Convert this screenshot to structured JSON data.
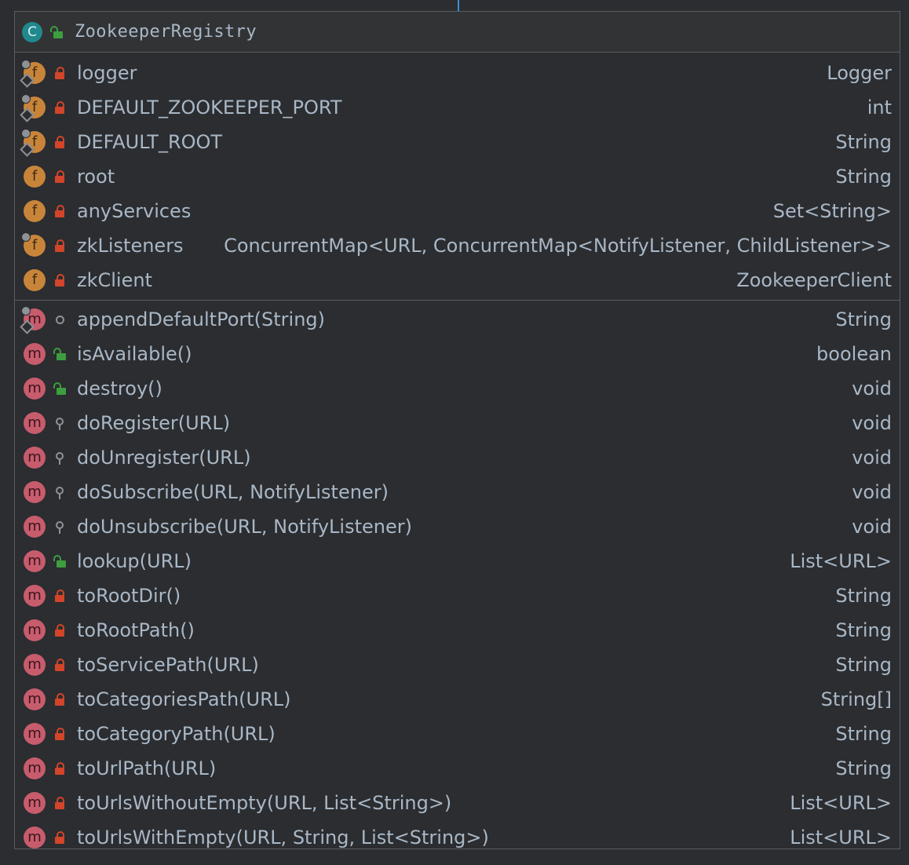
{
  "class": {
    "icon_letter": "C",
    "name": "ZookeeperRegistry",
    "visibility": "public"
  },
  "fields": [
    {
      "icon": "field-icon",
      "letter": "f",
      "static": true,
      "final": true,
      "visibility": "private",
      "name": "logger",
      "type": "Logger"
    },
    {
      "icon": "field-icon",
      "letter": "f",
      "static": true,
      "final": true,
      "visibility": "private",
      "name": "DEFAULT_ZOOKEEPER_PORT",
      "type": "int"
    },
    {
      "icon": "field-icon",
      "letter": "f",
      "static": true,
      "final": true,
      "visibility": "private",
      "name": "DEFAULT_ROOT",
      "type": "String"
    },
    {
      "icon": "field-icon",
      "letter": "f",
      "static": false,
      "final": false,
      "visibility": "private",
      "name": "root",
      "type": "String"
    },
    {
      "icon": "field-icon",
      "letter": "f",
      "static": false,
      "final": false,
      "visibility": "private",
      "name": "anyServices",
      "type": "Set<String>"
    },
    {
      "icon": "field-icon",
      "letter": "f",
      "static": true,
      "final": false,
      "visibility": "private",
      "name": "zkListeners",
      "type": "ConcurrentMap<URL, ConcurrentMap<NotifyListener, ChildListener>>"
    },
    {
      "icon": "field-icon",
      "letter": "f",
      "static": false,
      "final": false,
      "visibility": "private",
      "name": "zkClient",
      "type": "ZookeeperClient"
    }
  ],
  "methods": [
    {
      "icon": "method-icon",
      "letter": "m",
      "static": true,
      "final": true,
      "visibility": "package",
      "name": "appendDefaultPort(String)",
      "type": "String"
    },
    {
      "icon": "method-icon",
      "letter": "m",
      "static": false,
      "final": false,
      "visibility": "public",
      "name": "isAvailable()",
      "type": "boolean"
    },
    {
      "icon": "method-icon",
      "letter": "m",
      "static": false,
      "final": false,
      "visibility": "public",
      "name": "destroy()",
      "type": "void"
    },
    {
      "icon": "method-icon",
      "letter": "m",
      "static": false,
      "final": false,
      "visibility": "protected",
      "name": "doRegister(URL)",
      "type": "void"
    },
    {
      "icon": "method-icon",
      "letter": "m",
      "static": false,
      "final": false,
      "visibility": "protected",
      "name": "doUnregister(URL)",
      "type": "void"
    },
    {
      "icon": "method-icon",
      "letter": "m",
      "static": false,
      "final": false,
      "visibility": "protected",
      "name": "doSubscribe(URL, NotifyListener)",
      "type": "void"
    },
    {
      "icon": "method-icon",
      "letter": "m",
      "static": false,
      "final": false,
      "visibility": "protected",
      "name": "doUnsubscribe(URL, NotifyListener)",
      "type": "void"
    },
    {
      "icon": "method-icon",
      "letter": "m",
      "static": false,
      "final": false,
      "visibility": "public",
      "name": "lookup(URL)",
      "type": "List<URL>"
    },
    {
      "icon": "method-icon",
      "letter": "m",
      "static": false,
      "final": false,
      "visibility": "private",
      "name": "toRootDir()",
      "type": "String"
    },
    {
      "icon": "method-icon",
      "letter": "m",
      "static": false,
      "final": false,
      "visibility": "private",
      "name": "toRootPath()",
      "type": "String"
    },
    {
      "icon": "method-icon",
      "letter": "m",
      "static": false,
      "final": false,
      "visibility": "private",
      "name": "toServicePath(URL)",
      "type": "String"
    },
    {
      "icon": "method-icon",
      "letter": "m",
      "static": false,
      "final": false,
      "visibility": "private",
      "name": "toCategoriesPath(URL)",
      "type": "String[]"
    },
    {
      "icon": "method-icon",
      "letter": "m",
      "static": false,
      "final": false,
      "visibility": "private",
      "name": "toCategoryPath(URL)",
      "type": "String"
    },
    {
      "icon": "method-icon",
      "letter": "m",
      "static": false,
      "final": false,
      "visibility": "private",
      "name": "toUrlPath(URL)",
      "type": "String"
    },
    {
      "icon": "method-icon",
      "letter": "m",
      "static": false,
      "final": false,
      "visibility": "private",
      "name": "toUrlsWithoutEmpty(URL, List<String>)",
      "type": "List<URL>"
    },
    {
      "icon": "method-icon",
      "letter": "m",
      "static": false,
      "final": false,
      "visibility": "private",
      "name": "toUrlsWithEmpty(URL, String, List<String>)",
      "type": "List<URL>"
    }
  ],
  "colors": {
    "background": "#2b2d30",
    "text": "#a9b7c6",
    "class_icon": "#21898e",
    "field_icon": "#c8853a",
    "method_icon": "#c75c6d",
    "private": "#d2452a",
    "public": "#3d9d3f",
    "border": "#5a5d61"
  }
}
